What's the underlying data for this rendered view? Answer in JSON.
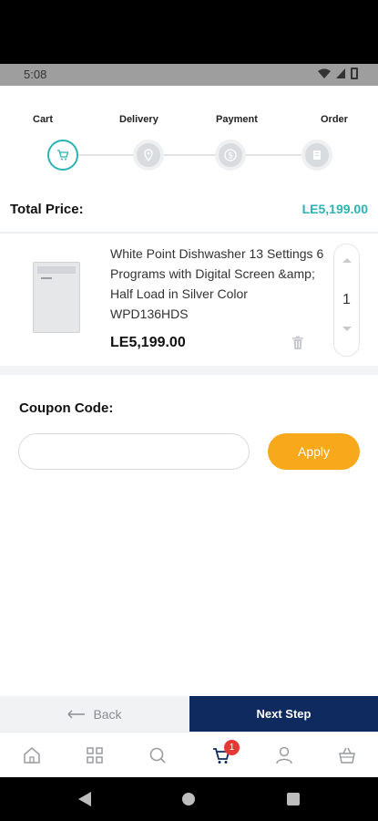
{
  "status_bar": {
    "time": "5:08"
  },
  "stepper": {
    "steps": [
      {
        "label": "Cart",
        "active": true
      },
      {
        "label": "Delivery",
        "active": false
      },
      {
        "label": "Payment",
        "active": false
      },
      {
        "label": "Order",
        "active": false
      }
    ]
  },
  "summary": {
    "total_label": "Total Price:",
    "total_value": "LE5,199.00"
  },
  "cart_item": {
    "title": "White Point Dishwasher 13 Settings 6 Programs with Digital Screen &amp; Half Load in Silver Color WPD136HDS",
    "price": "LE5,199.00",
    "quantity": "1"
  },
  "coupon": {
    "label": "Coupon Code:",
    "placeholder": "",
    "value": "",
    "apply_label": "Apply"
  },
  "footer": {
    "back_label": "Back",
    "next_label": "Next Step"
  },
  "tabbar": {
    "items": [
      "home-icon",
      "categories-icon",
      "search-icon",
      "cart-icon",
      "profile-icon",
      "basket-icon"
    ],
    "cart_badge": "1",
    "active": "cart-icon"
  },
  "colors": {
    "accent": "#2bb3b3",
    "primary": "#0f2a5e",
    "apply": "#f7a81b",
    "badge": "#e53935"
  }
}
